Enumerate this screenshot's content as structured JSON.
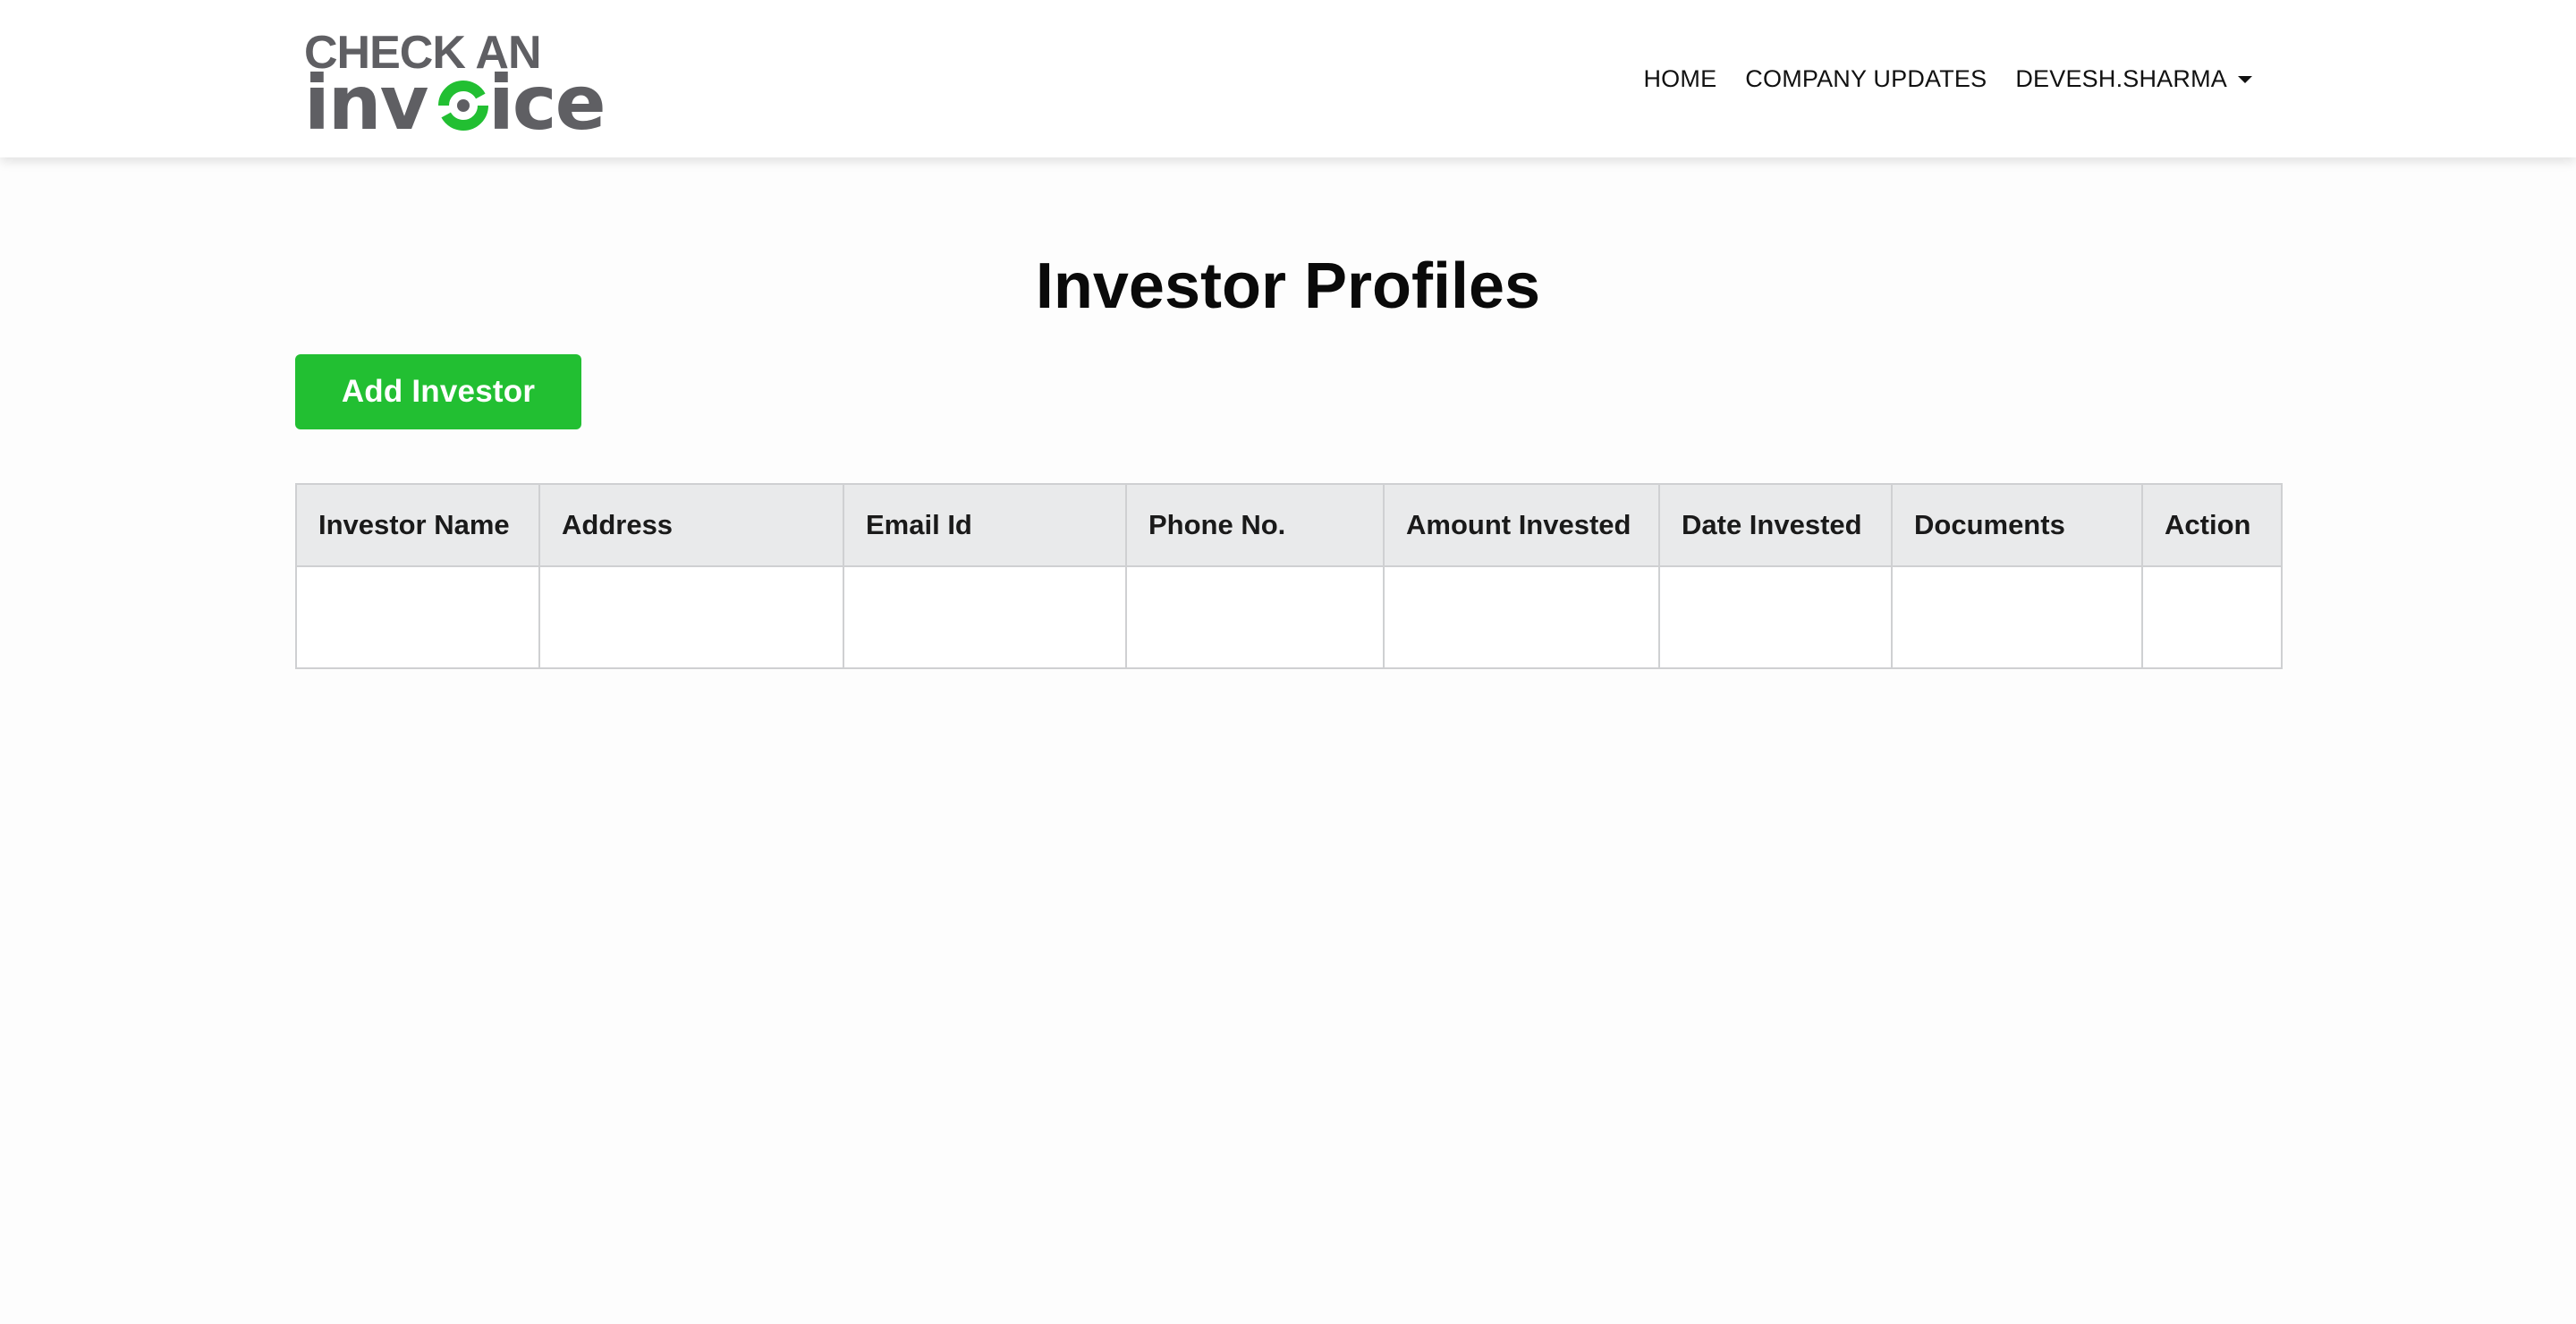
{
  "brand": {
    "logo_line1": "CHECK AN",
    "logo_line2_part1": "inv",
    "logo_line2_part2": "ice",
    "colors": {
      "gray": "#5f5f63",
      "green": "#22bf32"
    }
  },
  "nav": {
    "home": "HOME",
    "company_updates": "COMPANY UPDATES",
    "user": "DEVESH.SHARMA"
  },
  "page": {
    "title": "Investor Profiles",
    "add_button": "Add Investor"
  },
  "table": {
    "columns": [
      "Investor Name",
      "Address",
      "Email Id",
      "Phone No.",
      "Amount Invested",
      "Date Invested",
      "Documents",
      "Action"
    ]
  },
  "colors": {
    "accent": "#22bf32",
    "header_bg": "#e9eaeb",
    "border": "#cfd0d2"
  }
}
